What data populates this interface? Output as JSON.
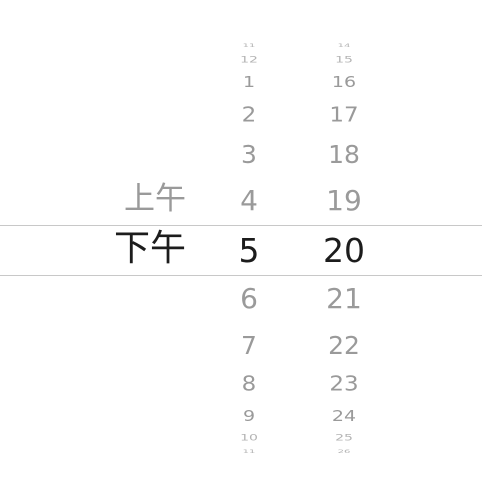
{
  "picker": {
    "meridiem": {
      "items": [
        {
          "label": "上午",
          "selected": false
        },
        {
          "label": "下午",
          "selected": true
        }
      ]
    },
    "hours": {
      "items": [
        "11",
        "12",
        "1",
        "2",
        "3",
        "4",
        "5",
        "6",
        "7",
        "8",
        "9",
        "10",
        "11"
      ],
      "selected": "5"
    },
    "minutes": {
      "items": [
        "14",
        "15",
        "16",
        "17",
        "18",
        "19",
        "20",
        "21",
        "22",
        "23",
        "24",
        "25",
        "26"
      ],
      "selected": "20"
    }
  }
}
